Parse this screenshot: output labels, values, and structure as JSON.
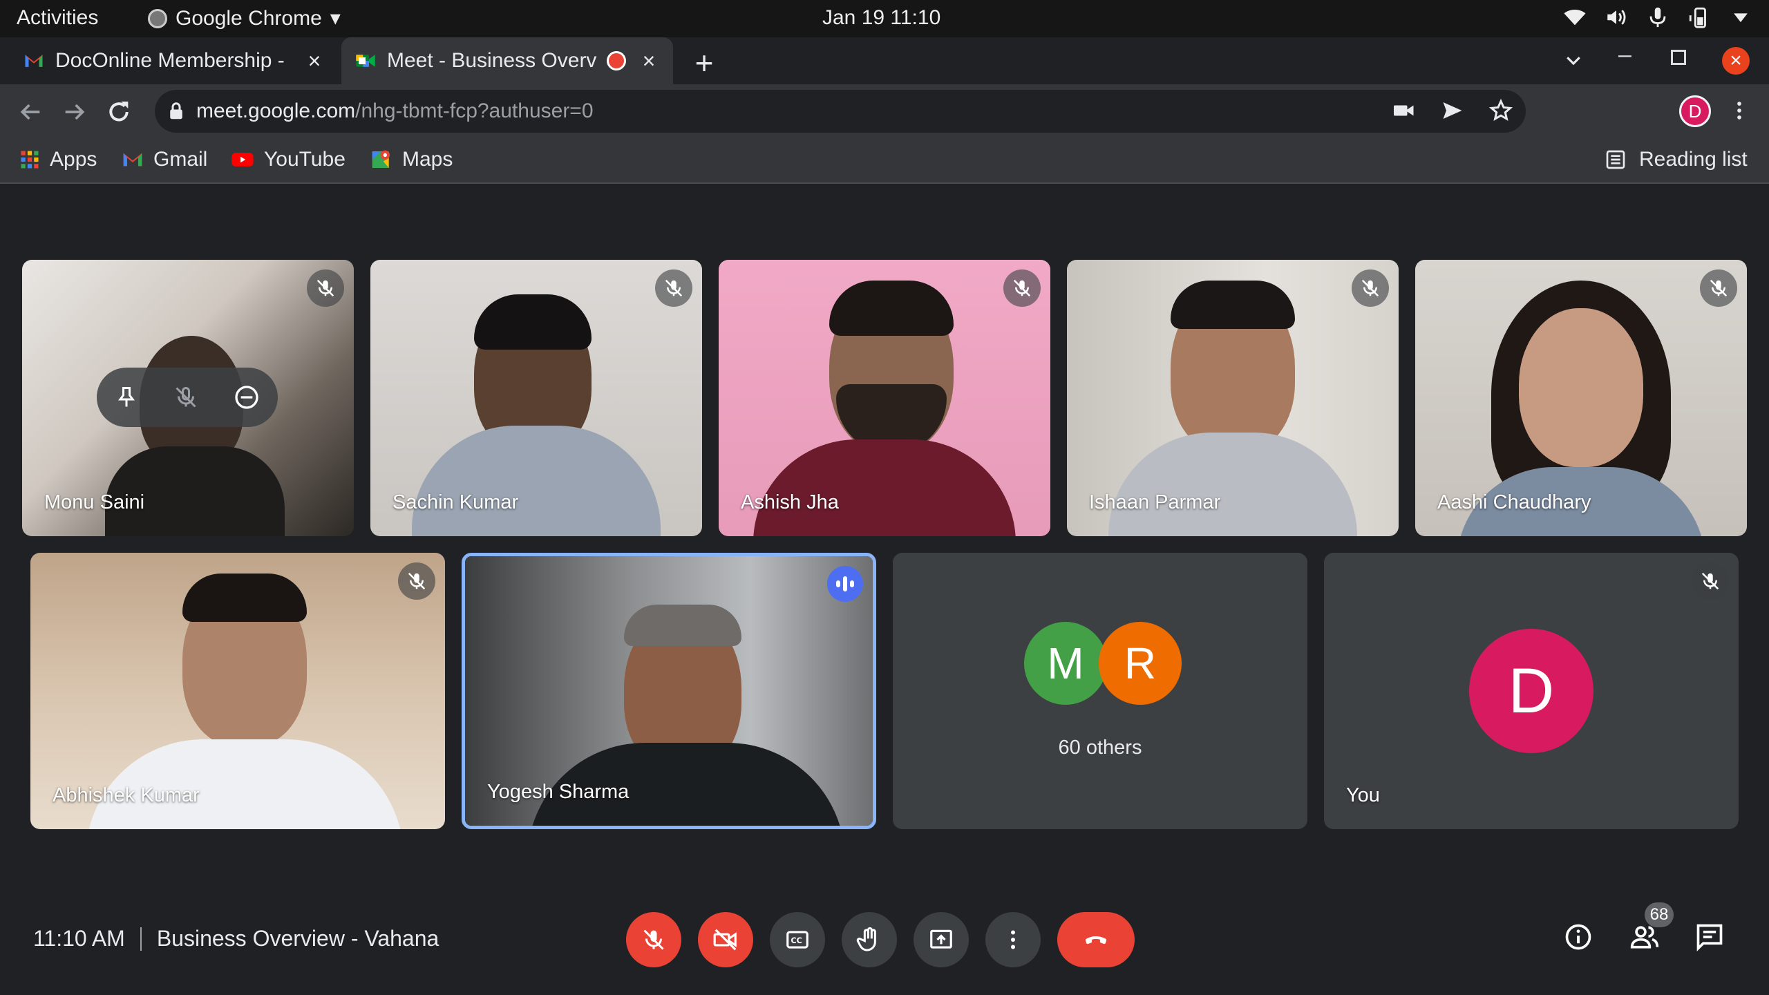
{
  "system_bar": {
    "activities": "Activities",
    "app_name": "Google Chrome",
    "datetime": "Jan 19  11:10"
  },
  "tabs": [
    {
      "title": "DocOnline Membership - ",
      "close": "×"
    },
    {
      "title": "Meet - Business Overv",
      "close": "×"
    }
  ],
  "new_tab": "+",
  "window": {
    "minimize": "–",
    "close": "×"
  },
  "address_bar": {
    "domain": "meet.google.com",
    "path": "/nhg-tbmt-fcp?authuser=0"
  },
  "profile_initial": "D",
  "bookmarks": [
    {
      "label": "Apps",
      "icon": "apps-grid-icon"
    },
    {
      "label": "Gmail",
      "icon": "gmail-icon"
    },
    {
      "label": "YouTube",
      "icon": "youtube-icon"
    },
    {
      "label": "Maps",
      "icon": "maps-icon"
    }
  ],
  "reading_list": "Reading list",
  "participants": [
    {
      "name": "Monu Saini",
      "muted": true
    },
    {
      "name": "Sachin Kumar",
      "muted": true
    },
    {
      "name": "Ashish Jha",
      "muted": true
    },
    {
      "name": "Ishaan Parmar",
      "muted": true
    },
    {
      "name": "Aashi Chaudhary",
      "muted": true
    },
    {
      "name": "Abhishek Kumar",
      "muted": true
    },
    {
      "name": "Yogesh Sharma",
      "muted": false,
      "speaking": true
    }
  ],
  "others_tile": {
    "avatars": [
      "M",
      "R"
    ],
    "label": "60 others"
  },
  "self_tile": {
    "initial": "D",
    "label": "You"
  },
  "meeting": {
    "time": "11:10 AM",
    "title": "Business Overview - Vahana"
  },
  "people_count": "68",
  "colors": {
    "background": "#202124",
    "danger": "#ea4335",
    "speaking_border": "#8ab4f8",
    "avatar_m": "#43a047",
    "avatar_r": "#ef6c00",
    "avatar_d": "#d81b60"
  }
}
